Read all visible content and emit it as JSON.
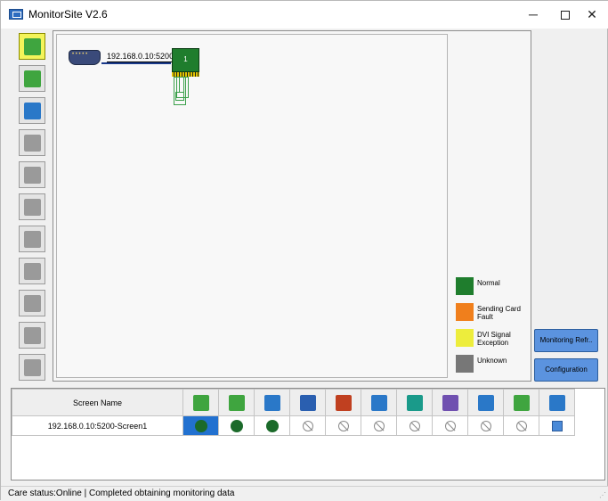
{
  "window": {
    "title": "MonitorSite V2.6",
    "min": "─",
    "close": "✕"
  },
  "toolbar": [
    {
      "name": "sending-card-icon",
      "color": "#3fa53f"
    },
    {
      "name": "receiving-card-icon",
      "color": "#3fa53f"
    },
    {
      "name": "temperature-icon",
      "color": "#2a78c8"
    },
    {
      "name": "cabinet-door-icon",
      "color": "#9a9a9a"
    },
    {
      "name": "humidity-icon",
      "color": "#9a9a9a"
    },
    {
      "name": "smoke-icon",
      "color": "#9a9a9a"
    },
    {
      "name": "fan-icon",
      "color": "#9a9a9a"
    },
    {
      "name": "voltage-icon",
      "color": "#9a9a9a"
    },
    {
      "name": "magnet-icon",
      "color": "#9a9a9a"
    },
    {
      "name": "door-exit-icon",
      "color": "#9a9a9a"
    },
    {
      "name": "module-icon",
      "color": "#9a9a9a"
    }
  ],
  "topology": {
    "ip_label": "192.168.0.10:5200",
    "card_number": "1"
  },
  "legend": [
    {
      "label": "Normal",
      "color": "#1f7d2d"
    },
    {
      "label": "Sending Card Fault",
      "color": "#f07f1c"
    },
    {
      "label": "DVI Signal Exception",
      "color": "#eded3c"
    },
    {
      "label": "Unknown",
      "color": "#777777"
    }
  ],
  "buttons": {
    "monitoring_refresh": "Monitoring Refr..",
    "configuration": "Configuration"
  },
  "table": {
    "header": "Screen Name",
    "columns": [
      {
        "name": "sending-card-icon",
        "color": "#3fa53f"
      },
      {
        "name": "receiving-card-icon",
        "color": "#3fa53f"
      },
      {
        "name": "temperature-icon",
        "color": "#2a78c8"
      },
      {
        "name": "cabinet-door-icon",
        "color": "#2a5fb0"
      },
      {
        "name": "smoke-icon",
        "color": "#c04020"
      },
      {
        "name": "fan-icon",
        "color": "#2a78c8"
      },
      {
        "name": "voltage-icon",
        "color": "#1a9a8a"
      },
      {
        "name": "magnet-icon",
        "color": "#7050b0"
      },
      {
        "name": "door-exit-icon",
        "color": "#2a78c8"
      },
      {
        "name": "module-icon",
        "color": "#3fa53f"
      },
      {
        "name": "network-icon",
        "color": "#2a78c8"
      }
    ],
    "rows": [
      {
        "screen_name": "192.168.0.10:5200-Screen1",
        "cells": [
          "ok",
          "ok",
          "ok",
          "na",
          "na",
          "na",
          "na",
          "na",
          "na",
          "na",
          "link"
        ]
      }
    ]
  },
  "status": {
    "text": "Care status:Online  |  Completed obtaining monitoring data"
  }
}
